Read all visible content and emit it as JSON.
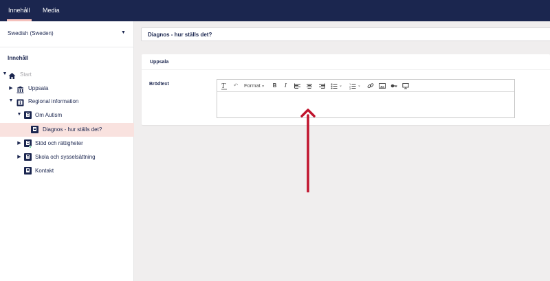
{
  "topbar": {
    "tabs": [
      {
        "label": "Innehåll",
        "active": true
      },
      {
        "label": "Media",
        "active": false
      }
    ],
    "background": "#1b264f",
    "active_indicator": "#f5c1bc"
  },
  "sidebar": {
    "language": "Swedish (Sweden)",
    "heading": "Innehåll",
    "tree": [
      {
        "label": "Start",
        "icon": "home-icon",
        "expanded": true,
        "muted": true
      },
      {
        "label": "Uppsala",
        "icon": "building-icon",
        "expanded": false
      },
      {
        "label": "Regional information",
        "icon": "info-doc-icon",
        "expanded": true
      },
      {
        "label": "Om Autism",
        "icon": "document-icon",
        "expanded": true
      },
      {
        "label": "Diagnos - hur ställs det?",
        "icon": "document-icon",
        "selected": true
      },
      {
        "label": "Stöd och rättigheter",
        "icon": "document-icon",
        "expanded": false,
        "badge": "green-dot"
      },
      {
        "label": "Skola och sysselsättning",
        "icon": "document-icon",
        "expanded": false
      },
      {
        "label": "Kontakt",
        "icon": "document-icon"
      }
    ]
  },
  "editor": {
    "node_name": "Diagnos - hur ställs det?",
    "group_title": "Uppsala",
    "property_label": "Brödtext",
    "toolbar": {
      "format_label": "Format",
      "buttons": [
        "remove-format-icon",
        "undo-icon",
        "format-dropdown",
        "bold-icon",
        "italic-icon",
        "align-left-icon",
        "align-center-icon",
        "align-right-icon",
        "bullet-list-icon",
        "numbered-list-icon",
        "link-icon",
        "image-icon",
        "macro-icon",
        "embed-icon"
      ]
    },
    "body_text": ""
  },
  "annotation": {
    "arrow_color": "#c0142d"
  }
}
